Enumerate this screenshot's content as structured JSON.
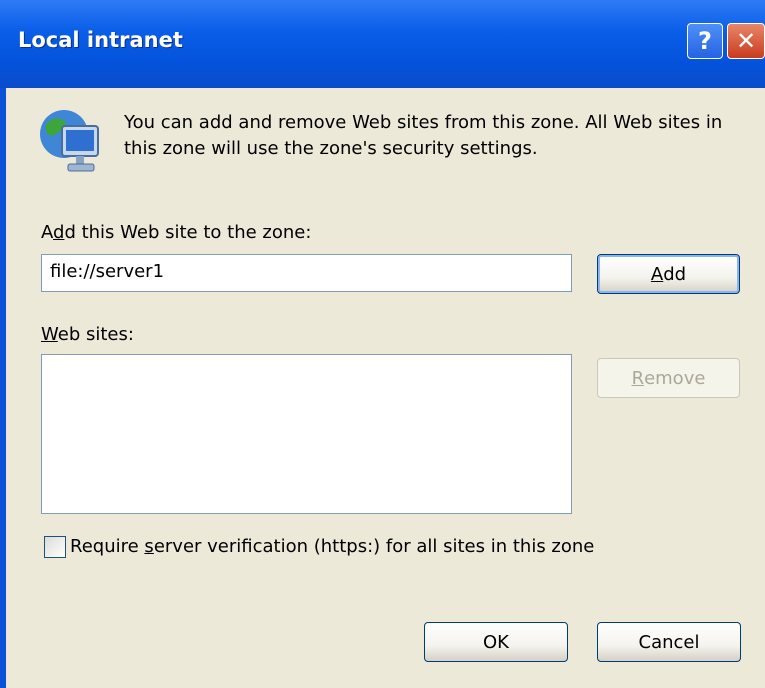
{
  "window": {
    "title": "Local intranet"
  },
  "titlebar": {
    "help_label": "?",
    "close_label": "✕"
  },
  "info": {
    "text": "You can add and remove Web sites from this zone. All Web sites in this zone will use the zone's security settings."
  },
  "add_site": {
    "label_pre": "A",
    "label_underlined": "d",
    "label_post": "d this Web site to the zone:",
    "value": "file://server1",
    "button_underlined": "A",
    "button_rest": "dd"
  },
  "web_sites": {
    "label_underlined": "W",
    "label_rest": "eb sites:",
    "items": [],
    "remove_underlined": "R",
    "remove_rest": "emove"
  },
  "verification": {
    "pre": "Require ",
    "underlined": "s",
    "post": "erver verification (https:) for all sites in this zone",
    "checked": false
  },
  "buttons": {
    "ok": "OK",
    "cancel": "Cancel"
  },
  "icons": {
    "zone": "globe-computer-icon"
  }
}
